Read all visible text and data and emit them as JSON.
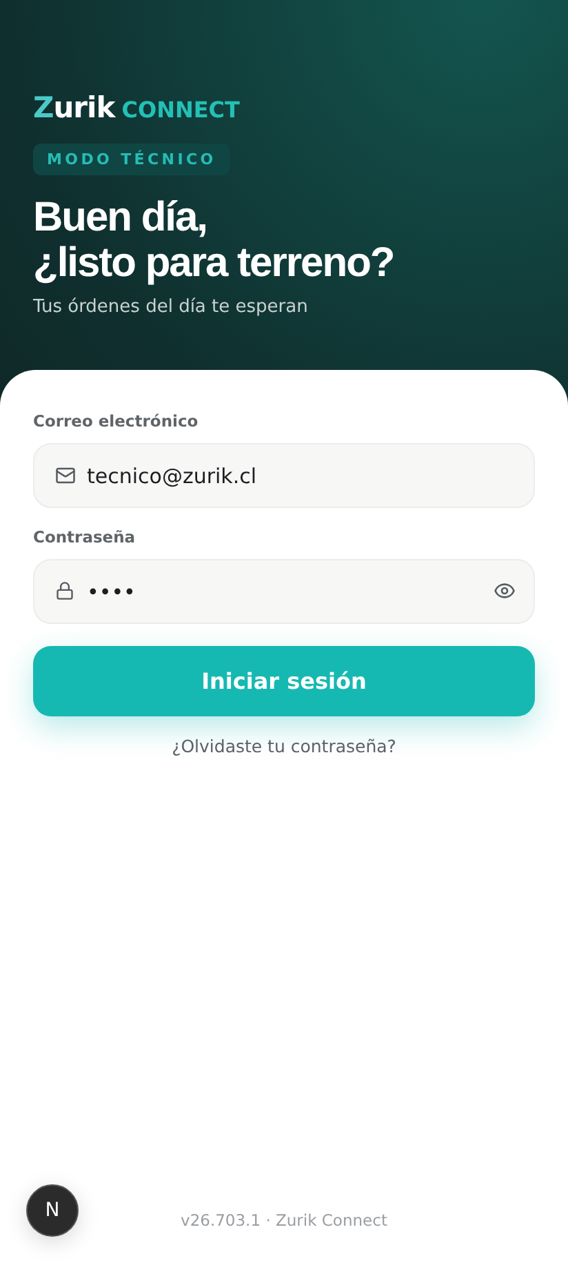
{
  "brand": {
    "name": "Zurik",
    "product": "CONNECT"
  },
  "mode_badge": "MODO TÉCNICO",
  "greeting": {
    "line_1": "Buen día,",
    "line_2": "¿listo para terreno?",
    "subtitle": "Tus órdenes del día te esperan"
  },
  "form": {
    "email": {
      "label": "Correo electrónico",
      "value": "tecnico@zurik.cl"
    },
    "password": {
      "label": "Contraseña",
      "value": "••••"
    },
    "submit": "Iniciar sesión",
    "forgot_link": "¿Olvidaste tu contraseña?"
  },
  "footer": "v26.703.1 · Zurik Connect",
  "dev_badge": "N"
}
